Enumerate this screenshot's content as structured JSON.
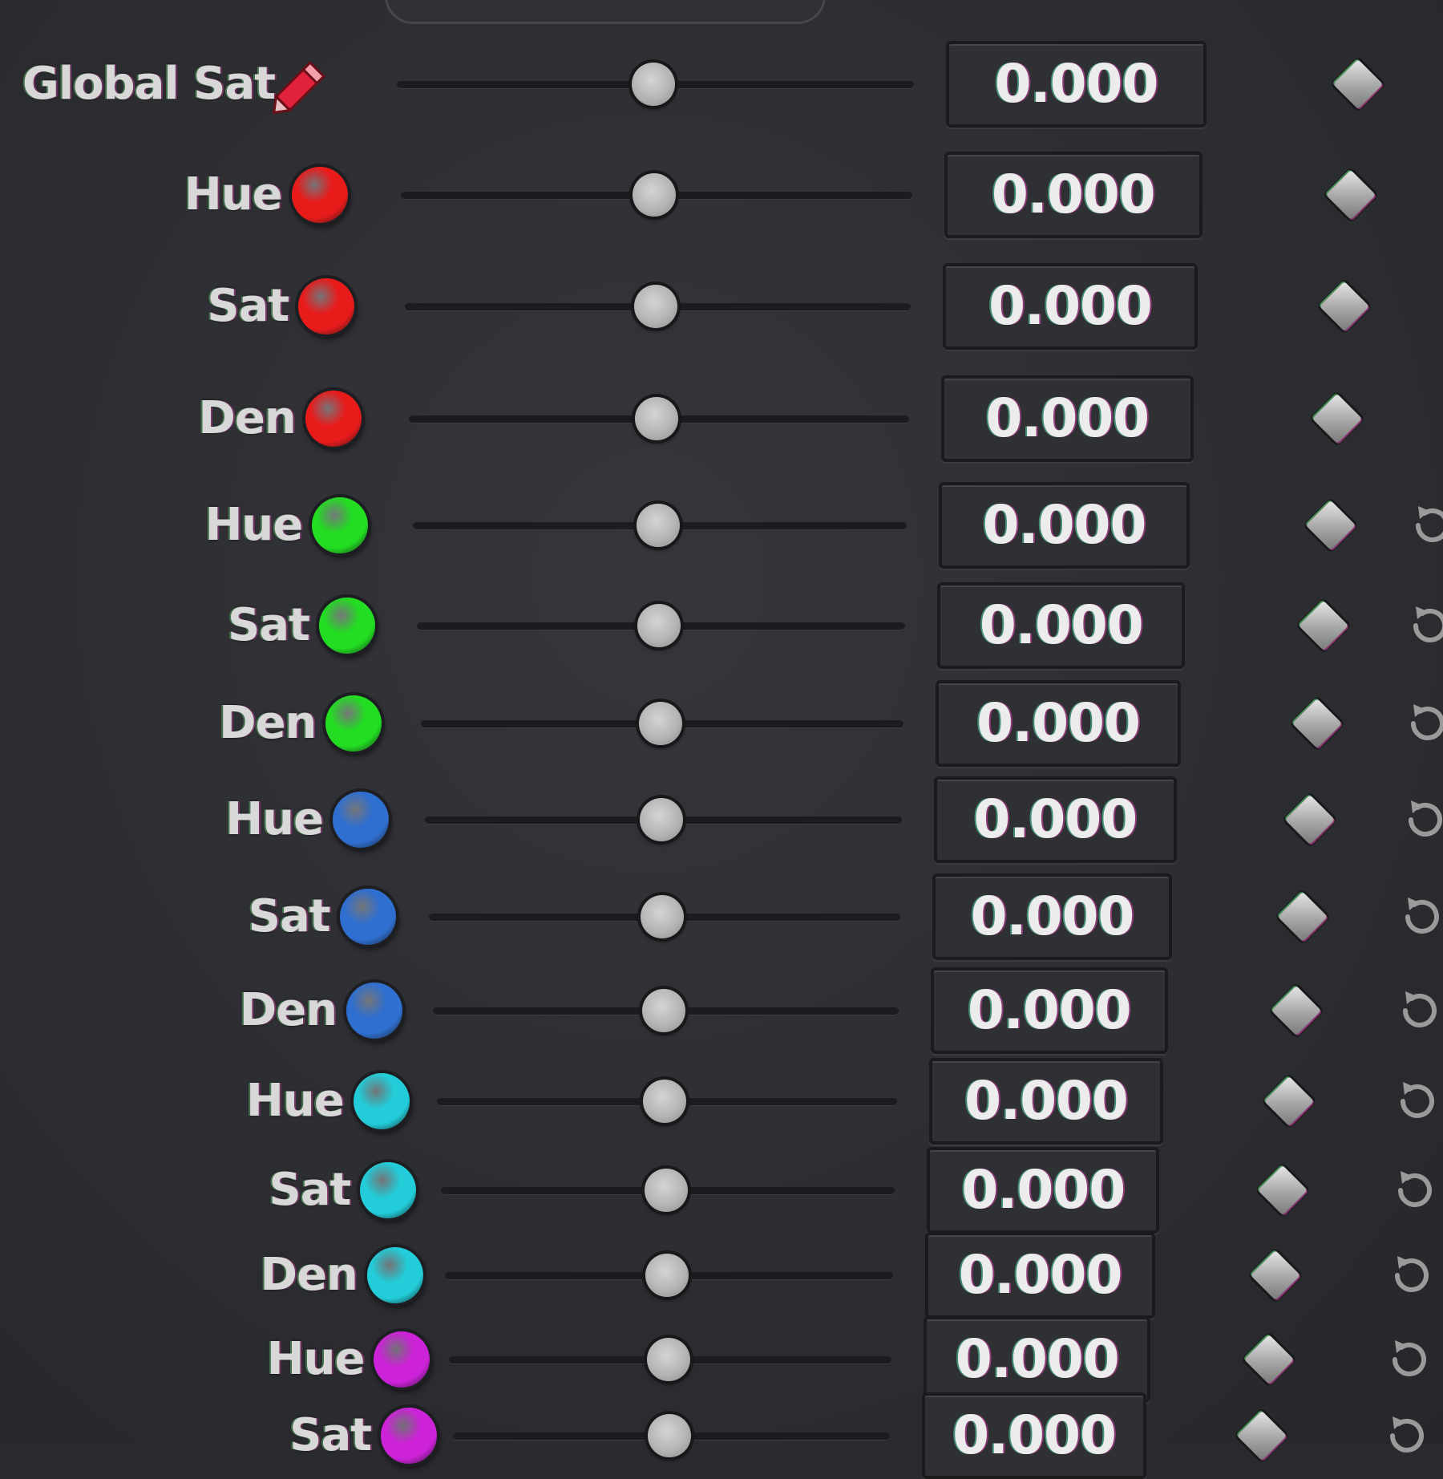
{
  "panel": {
    "colors": {
      "red": "#e81b1b",
      "green": "#22dd22",
      "blue": "#2f6fd0",
      "cyan": "#22ccd8",
      "magenta": "#cc22d8",
      "pencil": "#e0233a"
    },
    "rows": [
      {
        "label": "Global Sat",
        "icon": "pencil-icon",
        "color": "",
        "value": "0.000",
        "slider_value": 0.5
      },
      {
        "label": "Hue",
        "icon": "red-dot",
        "color": "#e81b1b",
        "value": "0.000",
        "slider_value": 0.5
      },
      {
        "label": "Sat",
        "icon": "red-dot",
        "color": "#e81b1b",
        "value": "0.000",
        "slider_value": 0.5
      },
      {
        "label": "Den",
        "icon": "red-dot",
        "color": "#e81b1b",
        "value": "0.000",
        "slider_value": 0.5
      },
      {
        "label": "Hue",
        "icon": "green-dot",
        "color": "#22dd22",
        "value": "0.000",
        "slider_value": 0.5
      },
      {
        "label": "Sat",
        "icon": "green-dot",
        "color": "#22dd22",
        "value": "0.000",
        "slider_value": 0.5
      },
      {
        "label": "Den",
        "icon": "green-dot",
        "color": "#22dd22",
        "value": "0.000",
        "slider_value": 0.5
      },
      {
        "label": "Hue",
        "icon": "blue-dot",
        "color": "#2f6fd0",
        "value": "0.000",
        "slider_value": 0.5
      },
      {
        "label": "Sat",
        "icon": "blue-dot",
        "color": "#2f6fd0",
        "value": "0.000",
        "slider_value": 0.5
      },
      {
        "label": "Den",
        "icon": "blue-dot",
        "color": "#2f6fd0",
        "value": "0.000",
        "slider_value": 0.5
      },
      {
        "label": "Hue",
        "icon": "cyan-dot",
        "color": "#22ccd8",
        "value": "0.000",
        "slider_value": 0.5
      },
      {
        "label": "Sat",
        "icon": "cyan-dot",
        "color": "#22ccd8",
        "value": "0.000",
        "slider_value": 0.5
      },
      {
        "label": "Den",
        "icon": "cyan-dot",
        "color": "#22ccd8",
        "value": "0.000",
        "slider_value": 0.5
      },
      {
        "label": "Hue",
        "icon": "magenta-dot",
        "color": "#cc22d8",
        "value": "0.000",
        "slider_value": 0.5
      },
      {
        "label": "Sat",
        "icon": "magenta-dot",
        "color": "#cc22d8",
        "value": "0.000",
        "slider_value": 0.5
      }
    ]
  }
}
